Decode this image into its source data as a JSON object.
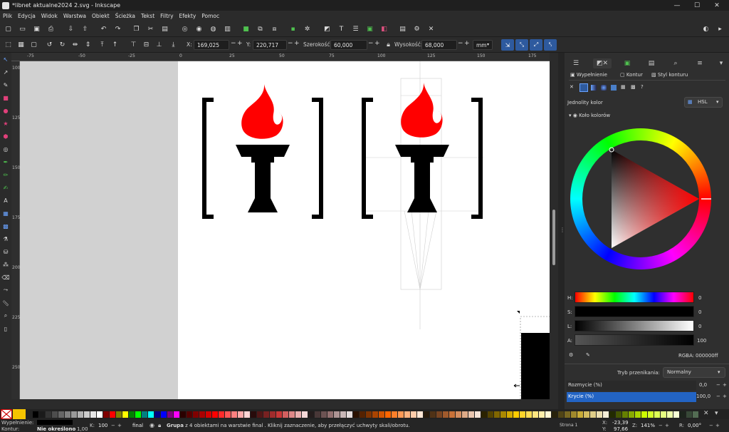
{
  "window": {
    "title": "*libnet aktualne2024 2.svg - Inkscape",
    "minimize_glyph": "—",
    "maximize_glyph": "☐",
    "close_glyph": "✕"
  },
  "menu": [
    "Plik",
    "Edycja",
    "Widok",
    "Warstwa",
    "Obiekt",
    "Ścieżka",
    "Tekst",
    "Filtry",
    "Efekty",
    "Pomoc"
  ],
  "toolbar": {
    "x_label": "X:",
    "x_value": "169,025",
    "y_label": "Y:",
    "y_value": "220,717",
    "width_label": "Szerokość:",
    "width_value": "60,000",
    "height_label": "Wysokość:",
    "height_value": "68,000",
    "unit": "mm",
    "minus": "−",
    "plus": "+"
  },
  "ruler": {
    "h_ticks": [
      "-75",
      "-50",
      "-25",
      "0",
      "25",
      "50",
      "75",
      "100",
      "125",
      "150",
      "175"
    ],
    "v_ticks": [
      "100",
      "125",
      "150",
      "175",
      "200",
      "225",
      "250"
    ]
  },
  "panel": {
    "tabs": {
      "fill": "Wypełnienie",
      "stroke": "Kontur",
      "stroke_style": "Styl konturu"
    },
    "paint_label": "Jednolity kolor",
    "color_mode": "HSL",
    "wheel_label": "Koło kolorów",
    "sliders": [
      {
        "label": "H:",
        "value": "0"
      },
      {
        "label": "S:",
        "value": "0"
      },
      {
        "label": "L:",
        "value": "0"
      },
      {
        "label": "A:",
        "value": "100"
      }
    ],
    "rgba_label": "RGBA:",
    "rgba_value": "000000ff",
    "blend_label": "Tryb przenikania:",
    "blend_value": "Normalny",
    "blur_label": "Rozmycie (%)",
    "blur_value": "0,0",
    "opacity_label": "Krycie (%)",
    "opacity_value": "100,0"
  },
  "status": {
    "fill_label": "Wypełnienie:",
    "stroke_label": "Kontur:",
    "stroke_value": "Nie określono",
    "stroke_width": "1,00",
    "opacity_label": "K:",
    "opacity_value": "100",
    "layer": "final",
    "message_bold": "Grupa",
    "message": "z 4 obiektami na warstwie final . Kliknij zaznaczenie, aby przełączyć uchwyty skali/obrotu.",
    "page_label": "Strona 1",
    "x_label": "X:",
    "x_value": "-23,39",
    "y_label": "Y:",
    "y_value": "97,66",
    "zoom_label": "Z:",
    "zoom_value": "141%",
    "rotation_label": "R:",
    "rotation_value": "0,00°"
  },
  "colors": {
    "accent": "#2e5a9e",
    "flame": "#ff0000",
    "fill_swatch": "#f5c400"
  }
}
